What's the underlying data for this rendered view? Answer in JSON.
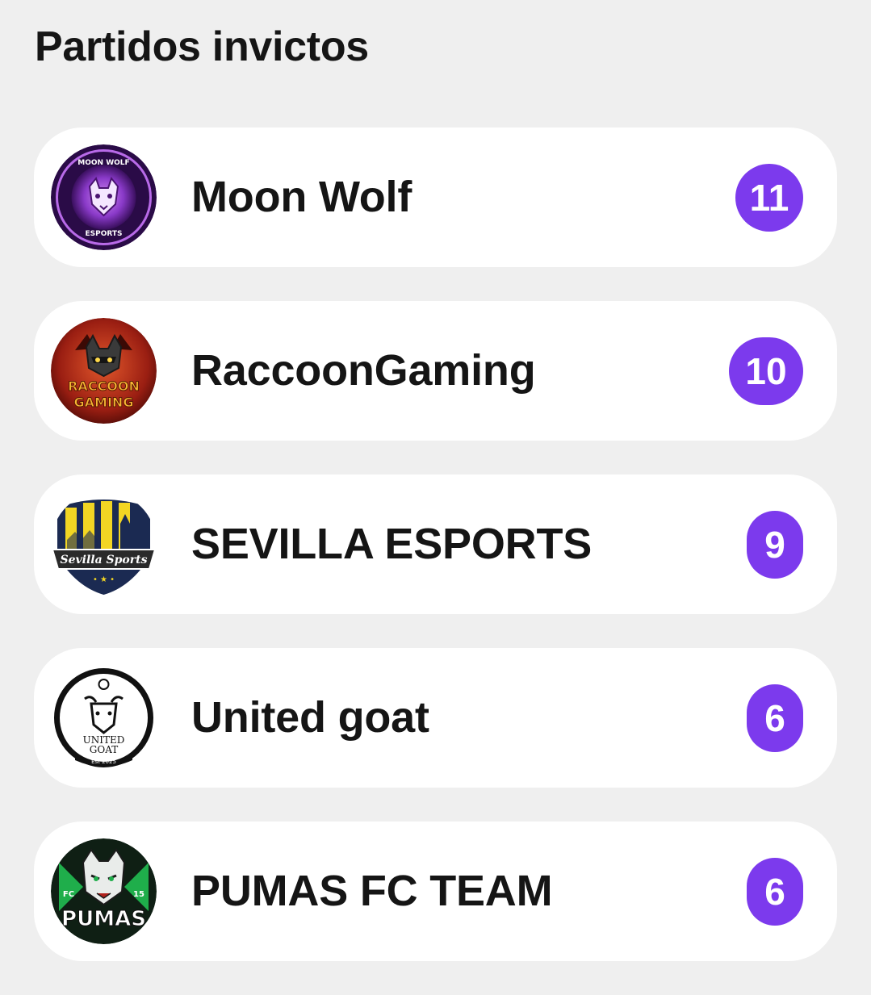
{
  "page": {
    "title": "Partidos invictos"
  },
  "colors": {
    "background": "#efefef",
    "card": "#ffffff",
    "badge": "#7c3aed",
    "badge_text": "#ffffff"
  },
  "teams": [
    {
      "name": "Moon Wolf",
      "count": "11",
      "logo": "moon-wolf-logo",
      "logo_text": [
        "MOON WOLF",
        "ESPORTS"
      ]
    },
    {
      "name": "RaccoonGaming",
      "count": "10",
      "logo": "raccoon-gaming-logo",
      "logo_text": [
        "RACCOON",
        "GAMING"
      ]
    },
    {
      "name": "SEVILLA ESPORTS",
      "count": "9",
      "logo": "sevilla-esports-logo",
      "logo_text": [
        "Sevilla Sports"
      ]
    },
    {
      "name": "United goat",
      "count": "6",
      "logo": "united-goat-logo",
      "logo_text": [
        "UNITED",
        "GOAT",
        "Est 2025"
      ]
    },
    {
      "name": "PUMAS FC TEAM",
      "count": "6",
      "logo": "pumas-fc-logo",
      "logo_text": [
        "PUMAS",
        "FC",
        "15"
      ]
    }
  ]
}
